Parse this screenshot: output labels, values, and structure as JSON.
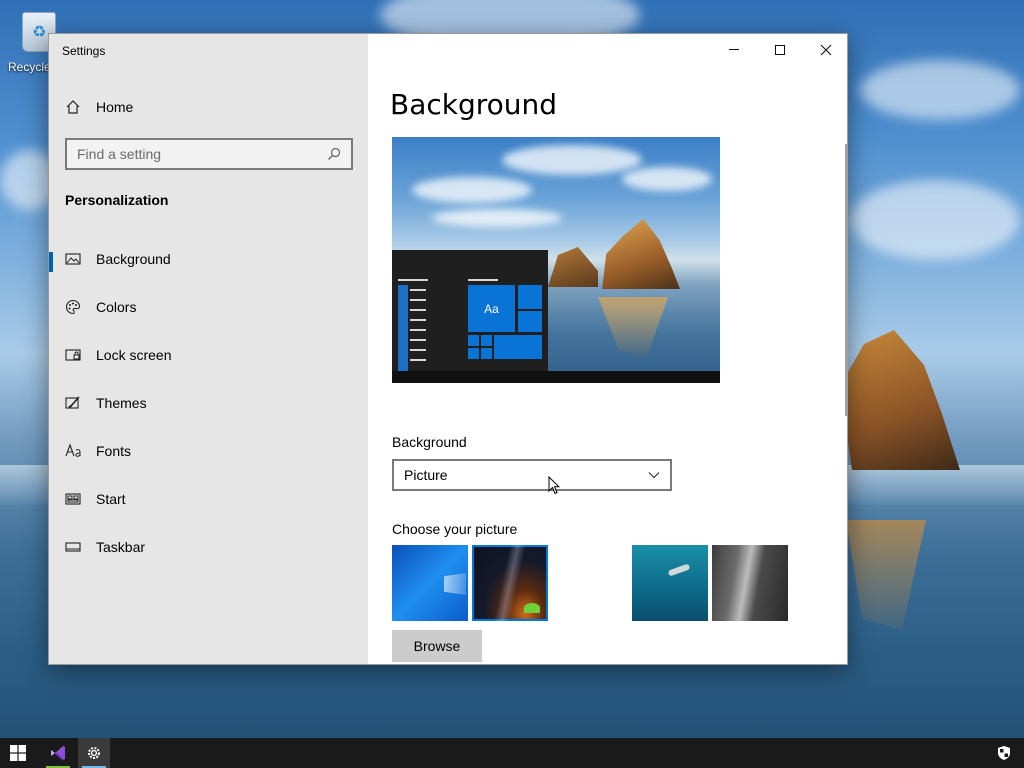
{
  "desktop": {
    "icons": [
      {
        "label": "Recycle Bin"
      }
    ]
  },
  "window": {
    "title": "Settings",
    "sidebar": {
      "home_label": "Home",
      "search_placeholder": "Find a setting",
      "section_title": "Personalization",
      "items": [
        {
          "label": "Background",
          "icon": "picture-icon",
          "selected": true
        },
        {
          "label": "Colors",
          "icon": "palette-icon",
          "selected": false
        },
        {
          "label": "Lock screen",
          "icon": "lock-screen-icon",
          "selected": false
        },
        {
          "label": "Themes",
          "icon": "brush-icon",
          "selected": false
        },
        {
          "label": "Fonts",
          "icon": "font-icon",
          "selected": false
        },
        {
          "label": "Start",
          "icon": "start-tiles-icon",
          "selected": false
        },
        {
          "label": "Taskbar",
          "icon": "taskbar-icon",
          "selected": false
        }
      ]
    },
    "main": {
      "page_title": "Background",
      "preview_tile_label": "Aa",
      "background_label": "Background",
      "background_value": "Picture",
      "choose_label": "Choose your picture",
      "browse_label": "Browse"
    }
  },
  "taskbar": {
    "apps": [
      "start-icon",
      "visual-studio-icon",
      "settings-gear-icon"
    ],
    "tray": [
      "security-shield-icon"
    ]
  },
  "colors": {
    "accent": "#0063b1",
    "sidebar_bg": "#e6e6e6",
    "taskbar_bg": "#1a1a1a"
  }
}
